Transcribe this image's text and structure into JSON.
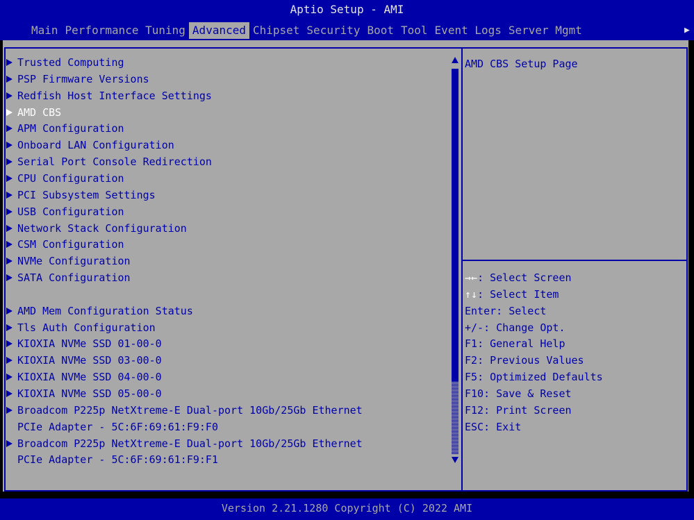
{
  "header": {
    "title": "Aptio Setup - AMI",
    "tabs": [
      "Main",
      "Performance Tuning",
      "Advanced",
      "Chipset",
      "Security",
      "Boot",
      "Tool",
      "Event Logs",
      "Server Mgmt"
    ],
    "active_tab": "Advanced",
    "more_tabs_icon": "right-arrow-icon"
  },
  "menu": {
    "items": [
      "Trusted Computing",
      "PSP Firmware Versions",
      "Redfish Host Interface Settings",
      "AMD CBS",
      "APM Configuration",
      "Onboard LAN Configuration",
      "Serial Port Console Redirection",
      "CPU Configuration",
      "PCI Subsystem Settings",
      "USB Configuration",
      "Network Stack Configuration",
      "CSM Configuration",
      "NVMe Configuration",
      "SATA Configuration",
      "AMD Mem Configuration Status",
      "Tls Auth Configuration",
      "KIOXIA NVMe SSD 01-00-0",
      "KIOXIA NVMe SSD 03-00-0",
      "KIOXIA NVMe SSD 04-00-0",
      "KIOXIA NVMe SSD 05-00-0",
      "Broadcom P225p NetXtreme-E Dual-port 10Gb/25Gb Ethernet",
      "Broadcom P225p NetXtreme-E Dual-port 10Gb/25Gb Ethernet"
    ],
    "continuations": [
      "PCIe Adapter - 5C:6F:69:61:F9:F0",
      "PCIe Adapter - 5C:6F:69:61:F9:F1"
    ],
    "selected_item": "AMD CBS"
  },
  "help": {
    "description": "AMD CBS Setup Page",
    "keys": [
      {
        "key": "→←",
        "action": ": Select Screen"
      },
      {
        "key": "↑↓",
        "action": ": Select Item"
      },
      {
        "key": "Enter",
        "action": ": Select"
      },
      {
        "key": "+/-",
        "action": ": Change Opt."
      },
      {
        "key": "F1",
        "action": ": General Help"
      },
      {
        "key": "F2",
        "action": ": Previous Values"
      },
      {
        "key": "F5",
        "action": ": Optimized Defaults"
      },
      {
        "key": "F10",
        "action": ": Save & Reset"
      },
      {
        "key": "F12",
        "action": ": Print Screen"
      },
      {
        "key": "ESC",
        "action": ": Exit"
      }
    ]
  },
  "footer": {
    "version": "Version 2.21.1280 Copyright (C) 2022 AMI"
  },
  "colors": {
    "bar_blue": "#0000a8",
    "panel_gray": "#a8a8a8",
    "highlight_white": "#ffffff"
  }
}
